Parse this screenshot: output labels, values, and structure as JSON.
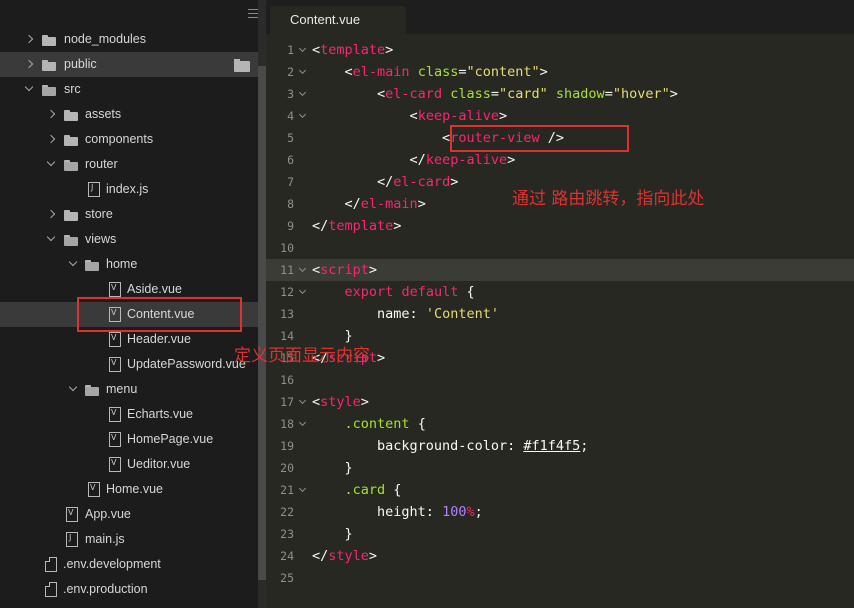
{
  "sidebar": {
    "items": [
      {
        "label": "node_modules",
        "type": "folder",
        "state": "closed",
        "depth": 0
      },
      {
        "label": "public",
        "type": "folder",
        "state": "closed",
        "depth": 0
      },
      {
        "label": "src",
        "type": "folder",
        "state": "open",
        "depth": 0
      },
      {
        "label": "assets",
        "type": "folder",
        "state": "closed",
        "depth": 1
      },
      {
        "label": "components",
        "type": "folder",
        "state": "closed",
        "depth": 1
      },
      {
        "label": "router",
        "type": "folder",
        "state": "open",
        "depth": 1
      },
      {
        "label": "index.js",
        "type": "js",
        "depth": 2
      },
      {
        "label": "store",
        "type": "folder",
        "state": "closed",
        "depth": 1
      },
      {
        "label": "views",
        "type": "folder",
        "state": "open",
        "depth": 1
      },
      {
        "label": "home",
        "type": "folder",
        "state": "open",
        "depth": 2
      },
      {
        "label": "Aside.vue",
        "type": "vue",
        "depth": 3
      },
      {
        "label": "Content.vue",
        "type": "vue",
        "depth": 3
      },
      {
        "label": "Header.vue",
        "type": "vue",
        "depth": 3
      },
      {
        "label": "UpdatePassword.vue",
        "type": "vue",
        "depth": 3
      },
      {
        "label": "menu",
        "type": "folder",
        "state": "open",
        "depth": 2
      },
      {
        "label": "Echarts.vue",
        "type": "vue",
        "depth": 3
      },
      {
        "label": "HomePage.vue",
        "type": "vue",
        "depth": 3
      },
      {
        "label": "Ueditor.vue",
        "type": "vue",
        "depth": 3
      },
      {
        "label": "Home.vue",
        "type": "vue",
        "depth": 2
      },
      {
        "label": "App.vue",
        "type": "vue",
        "depth": 1
      },
      {
        "label": "main.js",
        "type": "js",
        "depth": 1
      },
      {
        "label": ".env.development",
        "type": "plain",
        "depth": 0
      },
      {
        "label": ".env.production",
        "type": "plain",
        "depth": 0
      }
    ]
  },
  "editor": {
    "tab_label": "Content.vue",
    "line_numbers": [
      "1",
      "2",
      "3",
      "4",
      "5",
      "6",
      "7",
      "8",
      "9",
      "10",
      "11",
      "12",
      "13",
      "14",
      "15",
      "16",
      "17",
      "18",
      "19",
      "20",
      "21",
      "22",
      "23",
      "24",
      "25"
    ]
  },
  "annotations": {
    "router_note": "通过 路由跳转，指向此处",
    "content_note": "定义页面显示内容"
  },
  "colors": {
    "editor_bg": "#272822",
    "sidebar_bg": "#1c1c1c",
    "tag": "#f92672",
    "attr": "#a6e22e",
    "string": "#e6db74",
    "number": "#ae81ff",
    "annotation": "#e03131"
  }
}
